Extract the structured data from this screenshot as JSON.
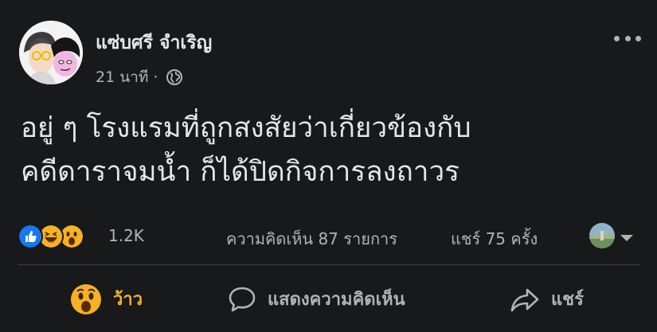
{
  "post": {
    "author": "แซ่บศรี จำเริญ",
    "time": "21 นาที",
    "separator": "·",
    "audience_icon": "globe-icon",
    "text_lines": [
      "อยู่ ๆ โรงแรมที่ถูกสงสัยว่าเกี่ยวข้องกับ",
      "คดีดาราจมน้ำ ก็ได้ปิดกิจการลงถาวร"
    ]
  },
  "stats": {
    "reactions": [
      "like-icon",
      "haha-icon",
      "wow-icon"
    ],
    "reaction_count": "1.2K",
    "comments": "ความคิดเห็น 87 รายการ",
    "shares": "แชร์ 75 ครั้ง"
  },
  "actions": {
    "reaction_label": "ว้าว",
    "comment_label": "แสดงความคิดเห็น",
    "share_label": "แชร์"
  },
  "colors": {
    "background": "#18191a",
    "primary_text": "#e4e6eb",
    "secondary_text": "#b0b3b8",
    "wow_accent": "#f7b125",
    "like_blue": "#1877f2",
    "divider": "#3e4042"
  }
}
